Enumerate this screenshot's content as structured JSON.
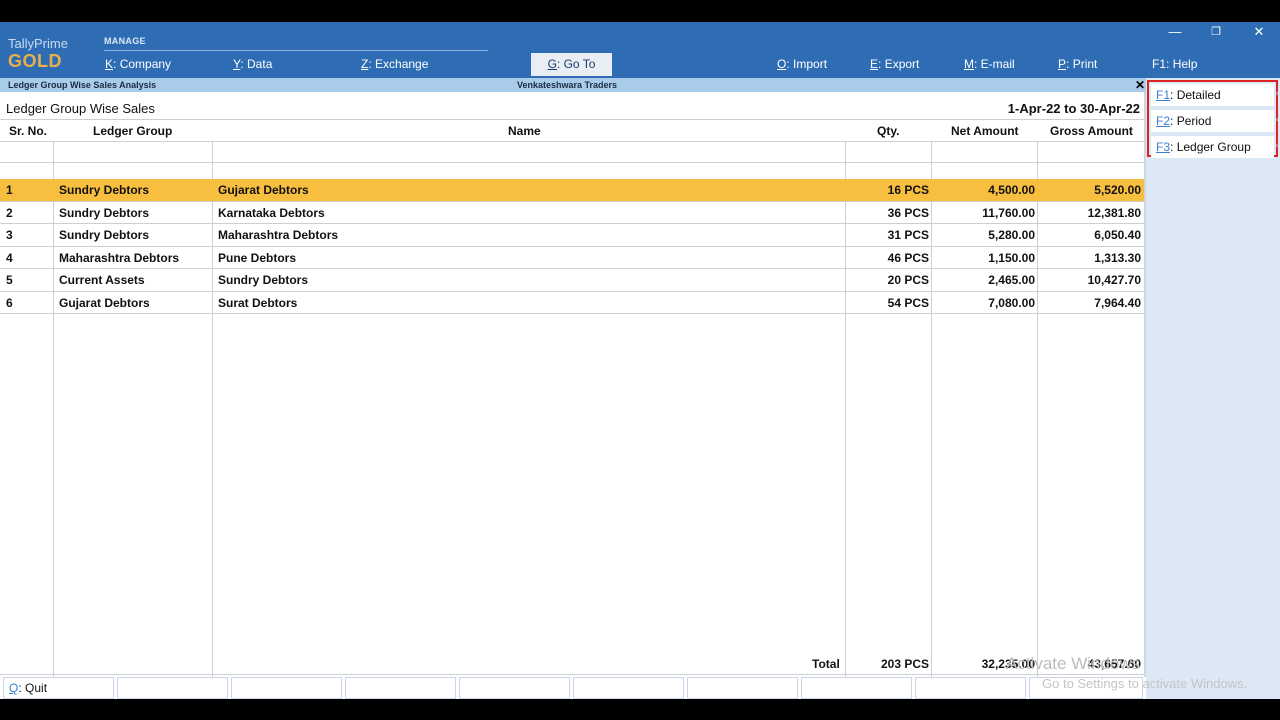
{
  "brand": {
    "line1": "TallyPrime",
    "line2": "GOLD"
  },
  "menu": {
    "section": "MANAGE",
    "items": [
      {
        "key": "K",
        "label": "Company"
      },
      {
        "key": "Y",
        "label": "Data"
      },
      {
        "key": "Z",
        "label": "Exchange"
      },
      {
        "key": "G",
        "label": "Go To"
      },
      {
        "key": "O",
        "label": "Import"
      },
      {
        "key": "E",
        "label": "Export"
      },
      {
        "key": "M",
        "label": "E-mail"
      },
      {
        "key": "P",
        "label": "Print"
      },
      {
        "key": "F1",
        "label": "Help"
      }
    ]
  },
  "window_controls": {
    "minimize": "—",
    "restore": "❐",
    "close": "✕"
  },
  "strip": {
    "left": "Ledger Group Wise Sales Analysis",
    "center": "Venkateshwara Traders",
    "close": "✕"
  },
  "report": {
    "title": "Ledger Group Wise Sales",
    "period": "1-Apr-22 to 30-Apr-22",
    "headers": [
      "Sr. No.",
      "Ledger Group",
      "Name",
      "Qty.",
      "Net Amount",
      "Gross Amount"
    ],
    "rows": [
      {
        "sr": "1",
        "group": "Sundry Debtors",
        "name": "Gujarat Debtors",
        "qty": "16 PCS",
        "net": "4,500.00",
        "gross": "5,520.00"
      },
      {
        "sr": "2",
        "group": "Sundry Debtors",
        "name": "Karnataka Debtors",
        "qty": "36 PCS",
        "net": "11,760.00",
        "gross": "12,381.80"
      },
      {
        "sr": "3",
        "group": "Sundry Debtors",
        "name": "Maharashtra Debtors",
        "qty": "31 PCS",
        "net": "5,280.00",
        "gross": "6,050.40"
      },
      {
        "sr": "4",
        "group": "Maharashtra Debtors",
        "name": "Pune Debtors",
        "qty": "46 PCS",
        "net": "1,150.00",
        "gross": "1,313.30"
      },
      {
        "sr": "5",
        "group": "Current Assets",
        "name": "Sundry Debtors",
        "qty": "20 PCS",
        "net": "2,465.00",
        "gross": "10,427.70"
      },
      {
        "sr": "6",
        "group": "Gujarat Debtors",
        "name": "Surat Debtors",
        "qty": "54 PCS",
        "net": "7,080.00",
        "gross": "7,964.40"
      }
    ],
    "totals": {
      "label": "Total",
      "qty": "203 PCS",
      "net": "32,235.00",
      "gross": "43,657.60"
    }
  },
  "bottombar": {
    "quit_key": "Q",
    "quit_label": "Quit"
  },
  "right_panel": {
    "buttons": [
      {
        "key": "F1",
        "label": "Detailed"
      },
      {
        "key": "F2",
        "label": "Period"
      },
      {
        "key": "F3",
        "label": "Ledger Group"
      }
    ]
  },
  "watermark": {
    "line1": "Activate Windows",
    "line2": "Go to Settings to activate Windows."
  },
  "colors": {
    "topbar": "#2E6DB4",
    "selected_row": "#F7BE3F",
    "strip": "#A9CCEB",
    "panel": "#DCE8F5",
    "highlight_border": "#dd2222"
  }
}
